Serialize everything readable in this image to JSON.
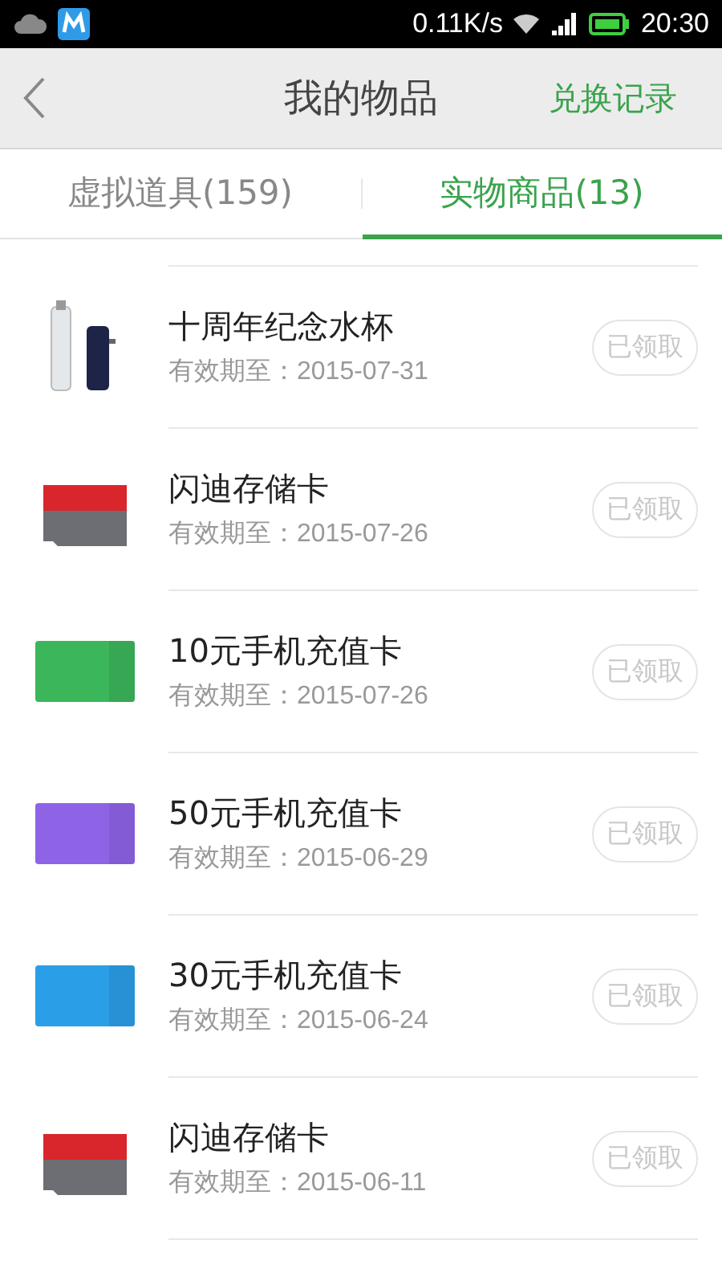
{
  "status_bar": {
    "speed": "0.11K/s",
    "time": "20:30"
  },
  "header": {
    "title": "我的物品",
    "action": "兑换记录"
  },
  "tabs": [
    {
      "label": "虚拟道具(159)",
      "selected": false
    },
    {
      "label": "实物商品(13)",
      "selected": true
    }
  ],
  "items": [
    {
      "kind": "bottle",
      "name": "十周年纪念水杯",
      "expiry": "有效期至：2015-07-31",
      "button": "已领取",
      "claimed": true
    },
    {
      "kind": "sdcard",
      "name": "闪迪存储卡",
      "expiry": "有效期至：2015-07-26",
      "button": "已领取",
      "claimed": true
    },
    {
      "kind": "phone-card",
      "color": "#3bb65a",
      "name": "10元手机充值卡",
      "expiry": "有效期至：2015-07-26",
      "button": "已领取",
      "claimed": true
    },
    {
      "kind": "phone-card",
      "color": "#8f63e6",
      "name": "50元手机充值卡",
      "expiry": "有效期至：2015-06-29",
      "button": "已领取",
      "claimed": true
    },
    {
      "kind": "phone-card",
      "color": "#2b9ee8",
      "name": "30元手机充值卡",
      "expiry": "有效期至：2015-06-24",
      "button": "已领取",
      "claimed": true
    },
    {
      "kind": "sdcard",
      "name": "闪迪存储卡",
      "expiry": "有效期至：2015-06-11",
      "button": "已领取",
      "claimed": true
    }
  ]
}
